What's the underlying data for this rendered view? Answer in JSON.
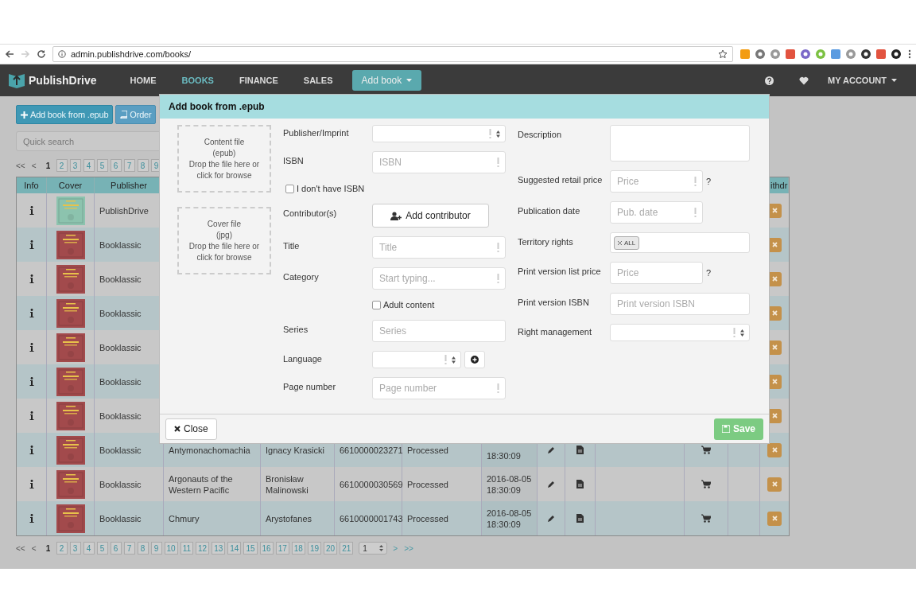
{
  "browser": {
    "url": "admin.publishdrive.com/books/",
    "forward_disabled": true
  },
  "nav": {
    "brand": "PublishDrive",
    "items": [
      {
        "label": "HOME",
        "selected": false
      },
      {
        "label": "BOOKS",
        "selected": true
      },
      {
        "label": "FINANCE",
        "selected": false
      },
      {
        "label": "SALES",
        "selected": false
      }
    ],
    "add_button": "Add book",
    "account": "MY ACCOUNT"
  },
  "toolbar": {
    "add_epub": "Add book from .epub",
    "order": "Order",
    "search_placeholder": "Quick search"
  },
  "pager_top": {
    "first": "<<",
    "prev": "<",
    "pages": [
      {
        "label": "1",
        "selected": true
      },
      {
        "label": "2",
        "selected": false
      },
      {
        "label": "3",
        "selected": false
      },
      {
        "label": "4",
        "selected": false
      },
      {
        "label": "5",
        "selected": false
      },
      {
        "label": "6",
        "selected": false
      },
      {
        "label": "7",
        "selected": false
      },
      {
        "label": "8",
        "selected": false
      },
      {
        "label": "9",
        "selected": false
      }
    ]
  },
  "table": {
    "columns": [
      "Info",
      "Cover",
      "Publisher",
      "ithdr"
    ],
    "rows": [
      {
        "publisher": "PublishDrive",
        "cover": {
          "kind": "picture",
          "color": "#8cc3ae"
        }
      },
      {
        "publisher": "Booklassic",
        "cover": {
          "kind": "picture",
          "color": "#a24a4c"
        }
      },
      {
        "publisher": "Booklassic",
        "cover": {
          "kind": "picture",
          "color": "#a24a4c"
        }
      },
      {
        "publisher": "Booklassic",
        "cover": {
          "kind": "picture",
          "color": "#a24a4c"
        }
      },
      {
        "publisher": "Booklassic",
        "cover": {
          "kind": "picture",
          "color": "#a24a4c"
        }
      },
      {
        "publisher": "Booklassic",
        "cover": {
          "kind": "picture",
          "color": "#a24a4c"
        }
      },
      {
        "publisher": "Booklassic",
        "cover": {
          "kind": "picture",
          "color": "#a24a4c"
        }
      },
      {
        "publisher": "Booklassic",
        "cover": {
          "kind": "picture",
          "color": "#a24a4c"
        },
        "title": "Antymonachomachia",
        "author": "Ignacy Krasicki",
        "isbn": "6610000023271",
        "status": "Processed",
        "date": [
          "18:30:09"
        ]
      },
      {
        "publisher": "Booklassic",
        "cover": {
          "kind": "picture",
          "color": "#a24a4c"
        },
        "title": "Argonauts of the Western Pacific",
        "author": "Bronisław Malinowski",
        "isbn": "6610000030569",
        "status": "Processed",
        "date": [
          "2016-08-05",
          "18:30:09"
        ]
      },
      {
        "publisher": "Booklassic",
        "cover": {
          "kind": "picture",
          "color": "#a24a4c"
        },
        "title": "Chmury",
        "author": "Arystofanes",
        "isbn": "6610000001743",
        "status": "Processed",
        "date": [
          "2016-08-05",
          "18:30:09"
        ]
      }
    ]
  },
  "pager_bottom": {
    "first": "<<",
    "prev": "<",
    "pages": [
      {
        "label": "1",
        "selected": true
      },
      {
        "label": "2",
        "selected": false
      },
      {
        "label": "3",
        "selected": false
      },
      {
        "label": "4",
        "selected": false
      },
      {
        "label": "5",
        "selected": false
      },
      {
        "label": "6",
        "selected": false
      },
      {
        "label": "7",
        "selected": false
      },
      {
        "label": "8",
        "selected": false
      },
      {
        "label": "9",
        "selected": false
      },
      {
        "label": "10",
        "selected": false
      },
      {
        "label": "11",
        "selected": false
      },
      {
        "label": "12",
        "selected": false
      },
      {
        "label": "13",
        "selected": false
      },
      {
        "label": "14",
        "selected": false
      },
      {
        "label": "15",
        "selected": false
      },
      {
        "label": "16",
        "selected": false
      },
      {
        "label": "17",
        "selected": false
      },
      {
        "label": "18",
        "selected": false
      },
      {
        "label": "19",
        "selected": false
      },
      {
        "label": "20",
        "selected": false
      },
      {
        "label": "21",
        "selected": false
      }
    ],
    "select": "1",
    "next": ">",
    "last": ">>"
  },
  "modal": {
    "title": "Add book from .epub",
    "dropzones": [
      "Content file\n(epub)\nDrop the file here or\nclick for browse",
      "Cover file\n(jpg)\nDrop the file here or\nclick for browse"
    ],
    "left_fields": [
      {
        "kind": "select",
        "label": "Publisher/Imprint",
        "required": true
      },
      {
        "kind": "input",
        "label": "ISBN",
        "placeholder": "ISBN",
        "required": true
      },
      {
        "kind": "option",
        "text": "I don't have ISBN",
        "checked": false
      },
      {
        "kind": "button",
        "label": "Contributor(s)",
        "button": "Add contributor"
      },
      {
        "kind": "input",
        "label": "Title",
        "placeholder": "Title",
        "required": true
      },
      {
        "kind": "input",
        "label": "Category",
        "placeholder": "Start typing...",
        "required": true
      },
      {
        "kind": "checkbox",
        "text": "Adult content",
        "checked": false
      },
      {
        "kind": "input",
        "label": "Series",
        "placeholder": "Series",
        "required": false
      },
      {
        "kind": "select-add",
        "label": "Language",
        "required": true
      },
      {
        "kind": "input",
        "label": "Page number",
        "placeholder": "Page number",
        "required": true
      }
    ],
    "right_fields": [
      {
        "kind": "textarea",
        "label": "Description"
      },
      {
        "kind": "input",
        "label": "Suggested retail price",
        "placeholder": "Price",
        "required": true,
        "short": true,
        "help": "?"
      },
      {
        "kind": "input",
        "label": "Publication date",
        "placeholder": "Pub. date",
        "required": true,
        "short": true
      },
      {
        "kind": "tags",
        "label": "Territory rights",
        "tags": [
          "ALL"
        ]
      },
      {
        "kind": "input",
        "label": "Print version list price",
        "placeholder": "Price",
        "required": false,
        "short": true,
        "help": "?"
      },
      {
        "kind": "input",
        "label": "Print version ISBN",
        "placeholder": "Print version ISBN",
        "required": false,
        "short": false
      },
      {
        "kind": "select",
        "label": "Right management",
        "required": true
      }
    ],
    "close": "Close",
    "save": "Save"
  }
}
